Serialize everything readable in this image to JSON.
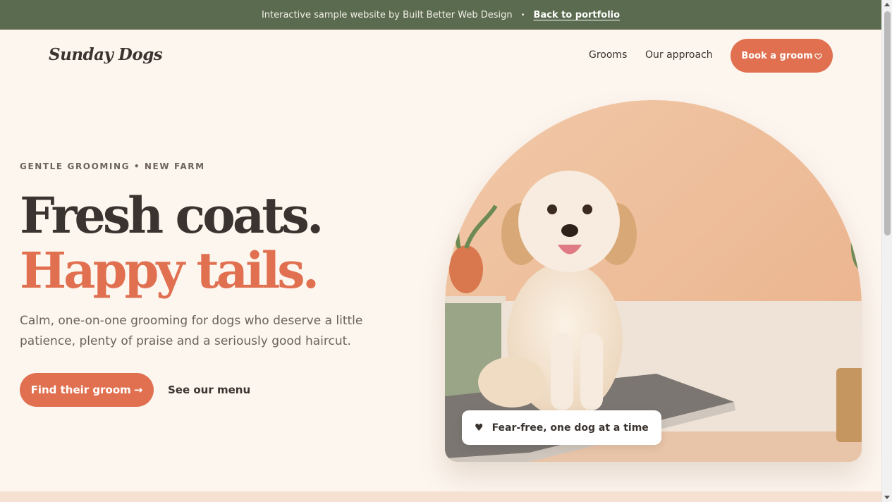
{
  "topbar": {
    "text": "Interactive sample website by Built Better Web Design",
    "separator": "•",
    "link_label": "Back to portfolio"
  },
  "nav": {
    "logo": "Sunday Dogs",
    "links": [
      {
        "label": "Grooms"
      },
      {
        "label": "Our approach"
      }
    ],
    "cta_label": "Book a groom",
    "cta_icon": "heart-icon"
  },
  "hero": {
    "eyebrow": "GENTLE GROOMING • NEW FARM",
    "headline_line1": "Fresh coats.",
    "headline_line2": "Happy tails.",
    "lede": "Calm, one-on-one grooming for dogs who deserve a little patience, plenty of praise and a seriously good haircut.",
    "primary_cta": "Find their groom",
    "primary_cta_arrow": "→",
    "secondary_cta": "See our menu"
  },
  "photo_badge": {
    "icon": "♥",
    "text": "Fear-free, one dog at a time"
  },
  "colors": {
    "topbar_bg": "#5b6b4f",
    "page_bg": "#fdf6ef",
    "accent": "#e07050",
    "text_dark": "#3a3430"
  }
}
